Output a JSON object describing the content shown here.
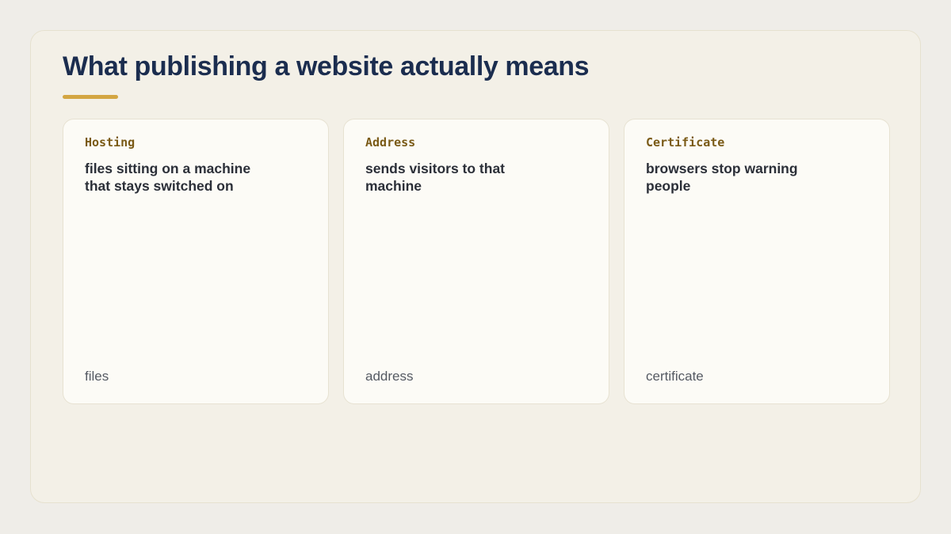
{
  "slide": {
    "title": "What publishing a website actually means"
  },
  "cards": [
    {
      "label": "Hosting",
      "description": "files sitting on a machine that stays switched on",
      "footer": "files"
    },
    {
      "label": "Address",
      "description": "sends visitors to that machine",
      "footer": "address"
    },
    {
      "label": "Certificate",
      "description": "browsers stop warning people",
      "footer": "certificate"
    }
  ],
  "colors": {
    "title": "#1b2d4f",
    "accent": "#d3a642",
    "label": "#7a5a16",
    "card_background": "#fcfbf6",
    "slide_background": "#f3f0e7"
  }
}
